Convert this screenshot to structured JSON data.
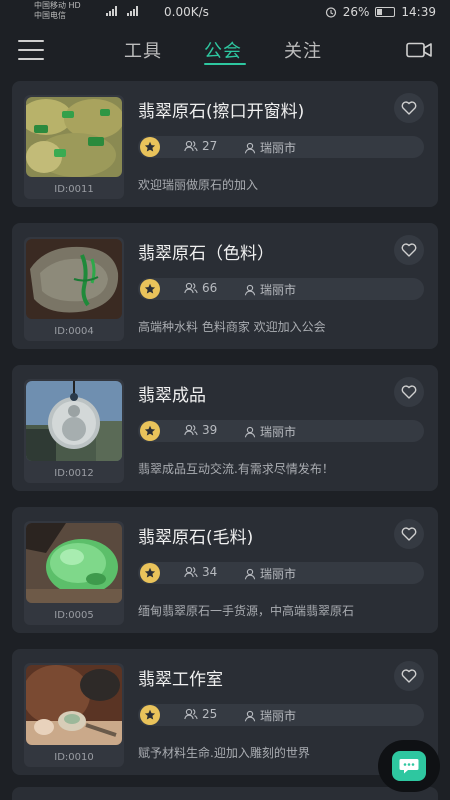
{
  "status_bar": {
    "carrier_line1": "中国移动 HD",
    "carrier_line2": "中国电信",
    "network_speed": "0.00K/s",
    "battery": "26%",
    "time": "14:39"
  },
  "nav": {
    "tabs": [
      {
        "label": "工具",
        "active": false
      },
      {
        "label": "公会",
        "active": true
      },
      {
        "label": "关注",
        "active": false
      }
    ],
    "accent_color": "#2ec7a0"
  },
  "guilds": [
    {
      "name": "翡翠原石(擦口开窗料)",
      "id": "ID:0011",
      "members": "27",
      "city": "瑞丽市",
      "desc": "欢迎瑞丽做原石的加入",
      "thumb": "rough-jade-green-window"
    },
    {
      "name": "翡翠原石（色料）",
      "id": "ID:0004",
      "members": "66",
      "city": "瑞丽市",
      "desc": "高端种水料 色料商家 欢迎加入公会",
      "thumb": "jade-boulder-green-vein"
    },
    {
      "name": "翡翠成品",
      "id": "ID:0012",
      "members": "39",
      "city": "瑞丽市",
      "desc": "翡翠成品互动交流.有需求尽情发布！",
      "thumb": "buddha-pendant"
    },
    {
      "name": "翡翠原石(毛料)",
      "id": "ID:0005",
      "members": "34",
      "city": "瑞丽市",
      "desc": "缅甸翡翠原石一手货源，中高端翡翠原石",
      "thumb": "green-jade-rough"
    },
    {
      "name": "翡翠工作室",
      "id": "ID:0010",
      "members": "25",
      "city": "瑞丽市",
      "desc": "赋予材料生命.迎加入雕刻的世界",
      "thumb": "carving-workshop"
    }
  ]
}
